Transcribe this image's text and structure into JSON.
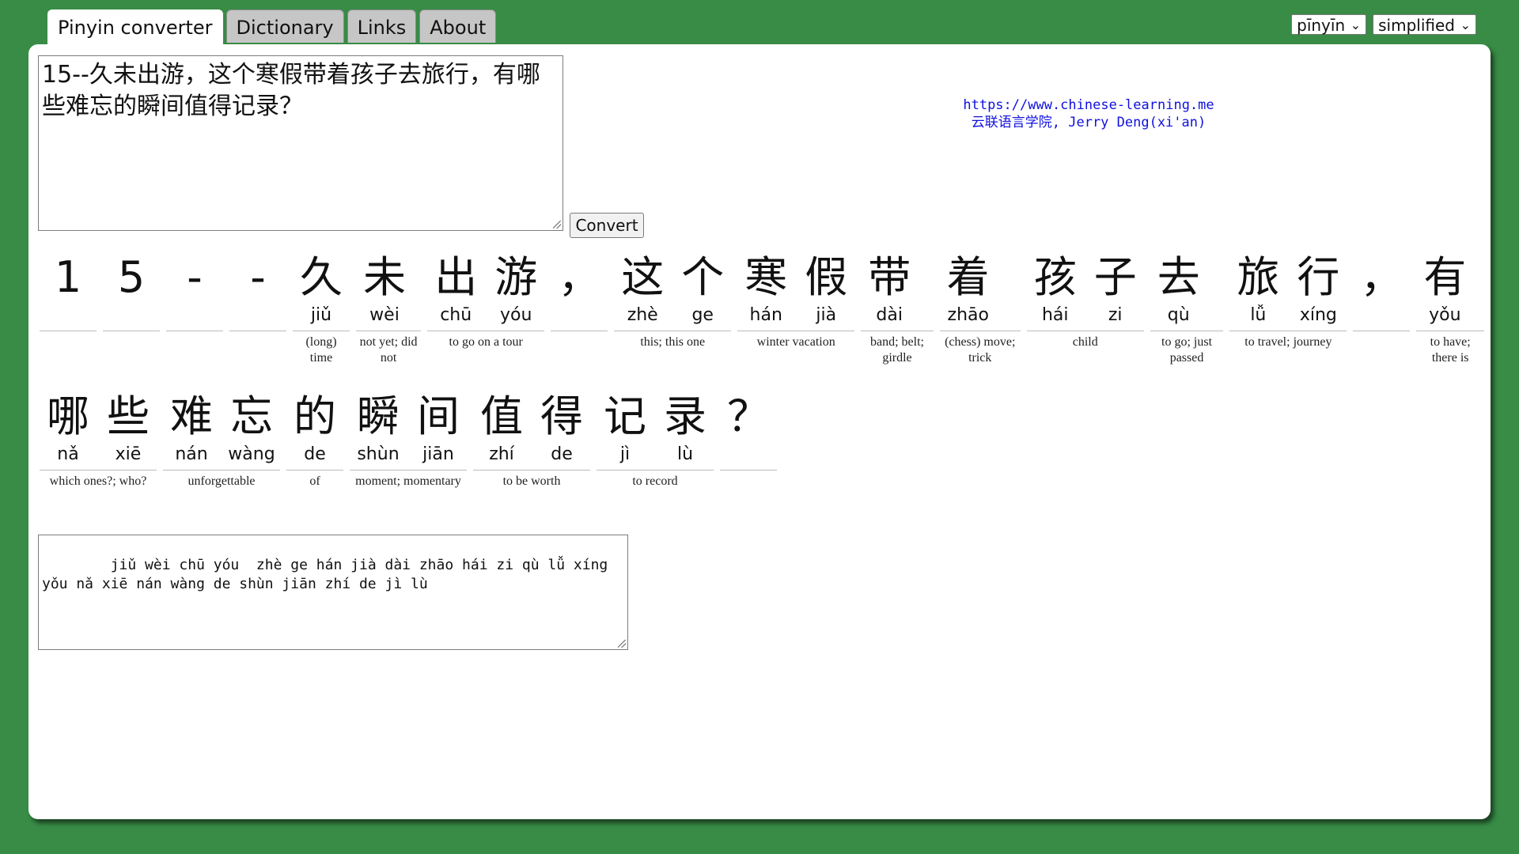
{
  "tabs": [
    {
      "label": "Pinyin converter",
      "active": true
    },
    {
      "label": "Dictionary",
      "active": false
    },
    {
      "label": "Links",
      "active": false
    },
    {
      "label": "About",
      "active": false
    }
  ],
  "selects": {
    "mode": "pīnyīn",
    "script": "simplified"
  },
  "input": {
    "value": "15--久未出游，这个寒假带着孩子去旅行，有哪些难忘的瞬间值得记录？"
  },
  "convert_label": "Convert",
  "credit": {
    "url": "https://www.chinese-learning.me",
    "author": "云联语言学院, Jerry Deng(xi'an)"
  },
  "row1": [
    {
      "chars": [
        {
          "h": "1",
          "p": ""
        }
      ],
      "gloss": ""
    },
    {
      "chars": [
        {
          "h": "5",
          "p": ""
        }
      ],
      "gloss": ""
    },
    {
      "chars": [
        {
          "h": "-",
          "p": ""
        }
      ],
      "gloss": ""
    },
    {
      "chars": [
        {
          "h": "-",
          "p": ""
        }
      ],
      "gloss": ""
    },
    {
      "chars": [
        {
          "h": "久",
          "p": "jiǔ"
        }
      ],
      "gloss": "(long) time"
    },
    {
      "chars": [
        {
          "h": "未",
          "p": "wèi"
        }
      ],
      "gloss": "not yet; did not"
    },
    {
      "chars": [
        {
          "h": "出",
          "p": "chū"
        },
        {
          "h": "游",
          "p": "yóu"
        }
      ],
      "gloss": "to go on a tour"
    },
    {
      "chars": [
        {
          "h": "，",
          "p": ""
        }
      ],
      "gloss": ""
    },
    {
      "chars": [
        {
          "h": "这",
          "p": "zhè"
        },
        {
          "h": "个",
          "p": "ge"
        }
      ],
      "gloss": "this; this one"
    },
    {
      "chars": [
        {
          "h": "寒",
          "p": "hán"
        },
        {
          "h": "假",
          "p": "jià"
        }
      ],
      "gloss": "winter vacation"
    },
    {
      "chars": [
        {
          "h": "带",
          "p": "dài"
        }
      ],
      "gloss": "band; belt; girdle"
    },
    {
      "chars": [
        {
          "h": "着",
          "p": "zhāo"
        }
      ],
      "gloss": "(chess) move; trick"
    },
    {
      "chars": [
        {
          "h": "孩",
          "p": "hái"
        },
        {
          "h": "子",
          "p": "zi"
        }
      ],
      "gloss": "child"
    },
    {
      "chars": [
        {
          "h": "去",
          "p": "qù"
        }
      ],
      "gloss": "to go; just passed"
    },
    {
      "chars": [
        {
          "h": "旅",
          "p": "lǚ"
        },
        {
          "h": "行",
          "p": "xíng"
        }
      ],
      "gloss": "to travel; journey"
    },
    {
      "chars": [
        {
          "h": "，",
          "p": ""
        }
      ],
      "gloss": ""
    },
    {
      "chars": [
        {
          "h": "有",
          "p": "yǒu"
        }
      ],
      "gloss": "to have; there is"
    }
  ],
  "row2": [
    {
      "chars": [
        {
          "h": "哪",
          "p": "nǎ"
        },
        {
          "h": "些",
          "p": "xiē"
        }
      ],
      "gloss": "which ones?; who?"
    },
    {
      "chars": [
        {
          "h": "难",
          "p": "nán"
        },
        {
          "h": "忘",
          "p": "wàng"
        }
      ],
      "gloss": "unforgettable"
    },
    {
      "chars": [
        {
          "h": "的",
          "p": "de"
        }
      ],
      "gloss": "of"
    },
    {
      "chars": [
        {
          "h": "瞬",
          "p": "shùn"
        },
        {
          "h": "间",
          "p": "jiān"
        }
      ],
      "gloss": "moment; momentary"
    },
    {
      "chars": [
        {
          "h": "值",
          "p": "zhí"
        },
        {
          "h": "得",
          "p": "de"
        }
      ],
      "gloss": "to be worth"
    },
    {
      "chars": [
        {
          "h": "记",
          "p": "jì"
        },
        {
          "h": "录",
          "p": "lù"
        }
      ],
      "gloss": "to record"
    },
    {
      "chars": [
        {
          "h": "？",
          "p": ""
        }
      ],
      "gloss": ""
    }
  ],
  "output": {
    "value": "    jiǔ wèi chū yóu  zhè ge hán jià dài zhāo hái zi qù lǚ xíng  yǒu nǎ xiē nán wàng de shùn jiān zhí de jì lù"
  }
}
